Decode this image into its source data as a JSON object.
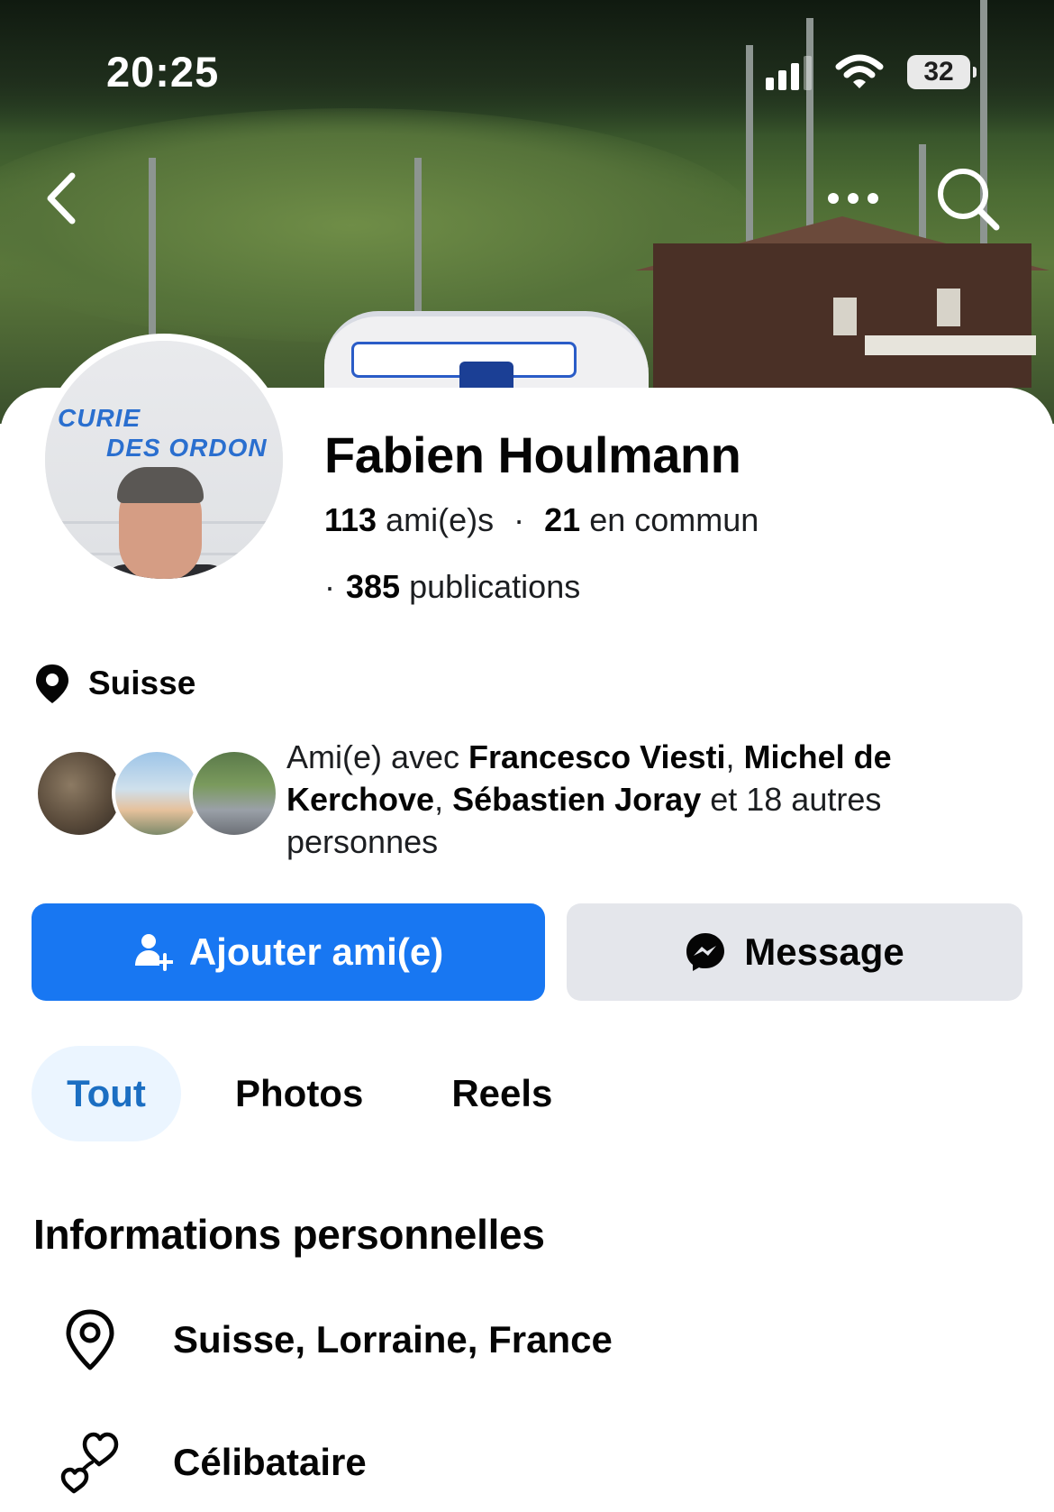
{
  "status_bar": {
    "time": "20:25",
    "battery": "32"
  },
  "header": {
    "back_icon": "chevron-left-icon",
    "more_icon": "ellipsis-icon",
    "search_icon": "search-icon"
  },
  "avatar": {
    "banner_line1": "CURIE",
    "banner_line2": "DES ORDON"
  },
  "profile": {
    "name": "Fabien Houlmann",
    "friends_count": "113",
    "friends_label": "ami(e)s",
    "mutual_count": "21",
    "mutual_label": "en commun",
    "posts_count": "385",
    "posts_label": "publications"
  },
  "location_chip": {
    "label": "Suisse",
    "icon": "location-pin-icon"
  },
  "mutual_friends": {
    "prefix": "Ami(e) avec ",
    "names": [
      "Francesco Viesti",
      "Michel de Kerchove",
      "Sébastien Joray"
    ],
    "suffix": " et 18 autres personnes"
  },
  "actions": {
    "add_friend": {
      "label": "Ajouter ami(e)",
      "icon": "add-friend-icon",
      "color": "#1877F2"
    },
    "message": {
      "label": "Message",
      "icon": "messenger-icon"
    }
  },
  "tabs": [
    {
      "label": "Tout",
      "active": true
    },
    {
      "label": "Photos",
      "active": false
    },
    {
      "label": "Reels",
      "active": false
    }
  ],
  "info_section": {
    "title": "Informations personnelles",
    "items": [
      {
        "icon": "location-outline-icon",
        "text": "Suisse, Lorraine, France"
      },
      {
        "icon": "hearts-icon",
        "text": "Célibataire"
      }
    ]
  }
}
